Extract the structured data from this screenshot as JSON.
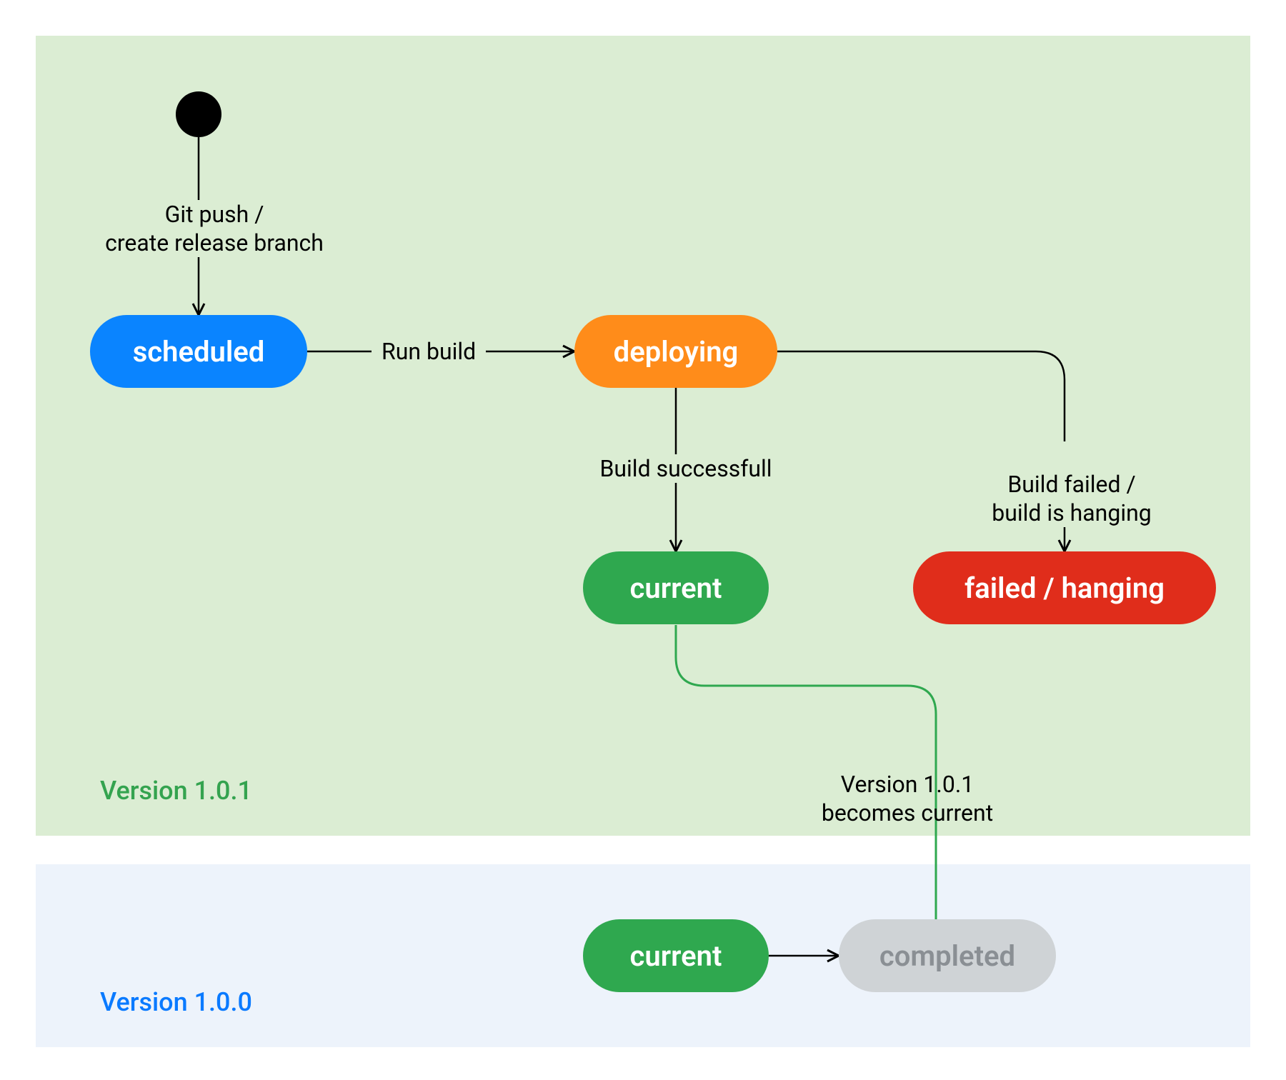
{
  "zones": {
    "top": {
      "label": "Version 1.0.1",
      "color": "#34a34f"
    },
    "bottom": {
      "label": "Version 1.0.0",
      "color": "#0a7aff"
    }
  },
  "nodes": {
    "start": {
      "kind": "start"
    },
    "scheduled": {
      "label": "scheduled",
      "fill": "#0a84ff",
      "text": "#ffffff"
    },
    "deploying": {
      "label": "deploying",
      "fill": "#ff8c1a",
      "text": "#ffffff"
    },
    "current1": {
      "label": "current",
      "fill": "#2fa84f",
      "text": "#ffffff"
    },
    "failed": {
      "label": "failed / hanging",
      "fill": "#e02d1b",
      "text": "#ffffff"
    },
    "current2": {
      "label": "current",
      "fill": "#2fa84f",
      "text": "#ffffff"
    },
    "completed": {
      "label": "completed",
      "fill": "#cfd3d6",
      "text": "#8a8f94"
    }
  },
  "edges": {
    "start_to_scheduled": {
      "label": "Git push /\ncreate release branch"
    },
    "scheduled_to_deploying": {
      "label": "Run build"
    },
    "deploying_to_current": {
      "label": "Build successfull"
    },
    "deploying_to_failed": {
      "label": "Build failed /\nbuild is hanging"
    },
    "current_to_completed": {
      "label": "Version 1.0.1\nbecomes current"
    }
  },
  "chart_data": {
    "type": "state-diagram",
    "swimlanes": [
      {
        "id": "v101",
        "label": "Version 1.0.1"
      },
      {
        "id": "v100",
        "label": "Version 1.0.0"
      }
    ],
    "states": [
      {
        "id": "start",
        "lane": "v101",
        "kind": "initial"
      },
      {
        "id": "scheduled",
        "lane": "v101",
        "label": "scheduled",
        "color": "#0a84ff"
      },
      {
        "id": "deploying",
        "lane": "v101",
        "label": "deploying",
        "color": "#ff8c1a"
      },
      {
        "id": "current1",
        "lane": "v101",
        "label": "current",
        "color": "#2fa84f"
      },
      {
        "id": "failed",
        "lane": "v101",
        "label": "failed / hanging",
        "color": "#e02d1b"
      },
      {
        "id": "current2",
        "lane": "v100",
        "label": "current",
        "color": "#2fa84f"
      },
      {
        "id": "completed",
        "lane": "v100",
        "label": "completed",
        "color": "#cfd3d6"
      }
    ],
    "transitions": [
      {
        "from": "start",
        "to": "scheduled",
        "label": "Git push / create release branch"
      },
      {
        "from": "scheduled",
        "to": "deploying",
        "label": "Run build"
      },
      {
        "from": "deploying",
        "to": "current1",
        "label": "Build successfull"
      },
      {
        "from": "deploying",
        "to": "failed",
        "label": "Build failed / build is hanging"
      },
      {
        "from": "current1",
        "to": "completed",
        "label": "Version 1.0.1 becomes current"
      },
      {
        "from": "current2",
        "to": "completed",
        "label": ""
      }
    ]
  }
}
